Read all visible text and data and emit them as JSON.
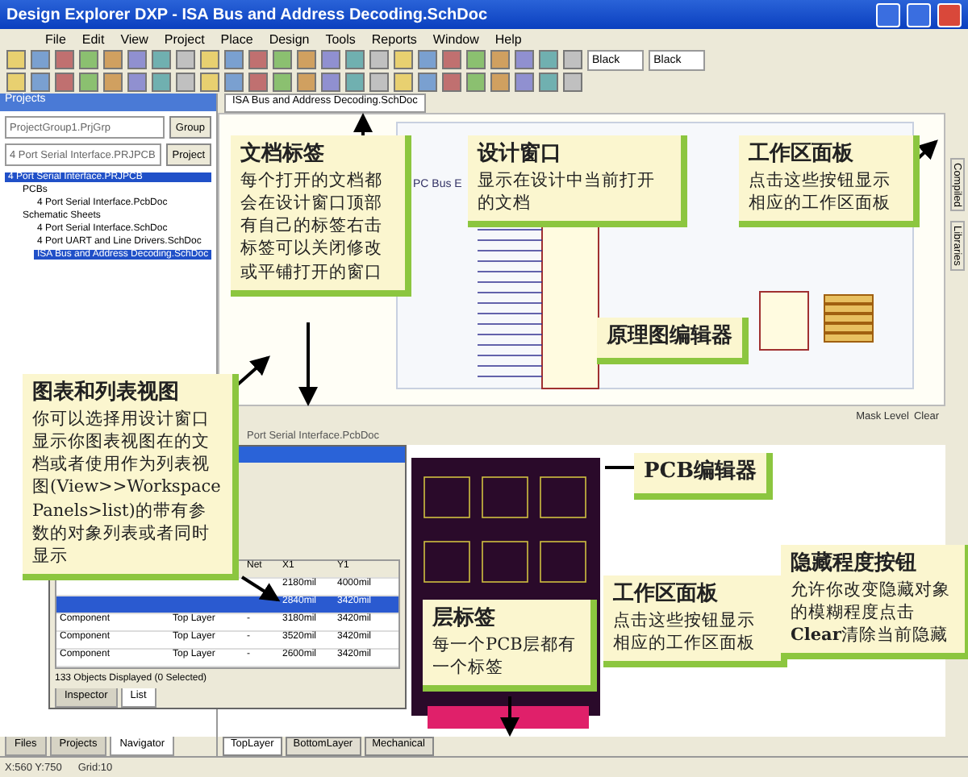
{
  "window": {
    "title": "Design Explorer DXP - ISA Bus and Address Decoding.SchDoc"
  },
  "menu": [
    "File",
    "Edit",
    "View",
    "Project",
    "Place",
    "Design",
    "Tools",
    "Reports",
    "Window",
    "Help"
  ],
  "toolbar": {
    "fill_color": "Black",
    "line_color": "Black"
  },
  "projects_panel": {
    "title": "Projects",
    "workspace": "ProjectGroup1.PrjGrp",
    "workspace_button": "Group",
    "project": "4 Port Serial Interface.PRJPCB",
    "project_button": "Project",
    "tree": [
      {
        "label": "4 Port Serial Interface.PRJPCB",
        "selected": true,
        "children": [
          {
            "label": "PCBs",
            "selected": false,
            "children": [
              {
                "label": "4 Port Serial Interface.PcbDoc",
                "selected": false
              }
            ]
          },
          {
            "label": "Schematic Sheets",
            "selected": false,
            "children": [
              {
                "label": "4 Port Serial Interface.SchDoc",
                "selected": false
              },
              {
                "label": "4 Port UART and Line Drivers.SchDoc",
                "selected": false
              },
              {
                "label": "ISA Bus and Address Decoding.SchDoc",
                "selected": true
              }
            ]
          }
        ]
      }
    ],
    "tabs": [
      {
        "label": "Files",
        "selected": false
      },
      {
        "label": "Projects",
        "selected": false
      },
      {
        "label": "Navigator",
        "selected": true
      }
    ]
  },
  "schematic_window": {
    "tab": "ISA Bus and Address Decoding.SchDoc",
    "sheet_label": "PC Bus E",
    "mask_level": "Mask Level",
    "clear": "Clear"
  },
  "side_panel_tabs": [
    "Compiled",
    "Libraries"
  ],
  "pcb_window": {
    "title": "Port Serial Interface.PcbDoc",
    "layer_tabs": [
      {
        "label": "TopLayer",
        "selected": true
      },
      {
        "label": "BottomLayer",
        "selected": false
      },
      {
        "label": "Mechanical",
        "selected": false
      }
    ]
  },
  "list_panel": {
    "columns": [
      "Net",
      "X1",
      "Y1"
    ],
    "rows": [
      {
        "x1": "2180mil",
        "y1": "4000mil",
        "selected": false
      },
      {
        "x1": "2840mil",
        "y1": "3420mil",
        "selected": true
      },
      {
        "object": "Component",
        "layer": "Top Layer",
        "net": "-",
        "x1": "3180mil",
        "y1": "3420mil",
        "selected": false
      },
      {
        "object": "Component",
        "layer": "Top Layer",
        "net": "-",
        "x1": "3520mil",
        "y1": "3420mil",
        "selected": false
      },
      {
        "object": "Component",
        "layer": "Top Layer",
        "net": "-",
        "x1": "2600mil",
        "y1": "3420mil",
        "selected": false
      }
    ],
    "summary": "133 Objects Displayed (0 Selected)",
    "tabs": [
      {
        "label": "Inspector",
        "selected": false
      },
      {
        "label": "List",
        "selected": true
      }
    ]
  },
  "status_bar": {
    "position": "X:560 Y:750",
    "grid": "Grid:10"
  },
  "callouts": [
    {
      "title": "文档标签",
      "body": "每个打开的文档都会在设计窗口顶部有自己的标签右击标签可以关闭修改或平铺打开的窗口"
    },
    {
      "title": "设计窗口",
      "body": "显示在设计中当前打开的文档"
    },
    {
      "title": "工作区面板",
      "body": "点击这些按钮显示相应的工作区面板"
    },
    {
      "title": "原理图编辑器"
    },
    {
      "title": "图表和列表视图",
      "body": "你可以选择用设计窗口显示你图表视图在的文档或者使用作为列表视图(View>>Workspace Panels>list)的带有参数的对象列表或者同时显示"
    },
    {
      "title": "PCB编辑器"
    },
    {
      "title": "层标签",
      "body": "每一个PCB层都有一个标签"
    },
    {
      "title": "工作区面板",
      "body": "点击这些按钮显示相应的工作区面板"
    },
    {
      "title": "隐藏程度按钮",
      "body": "允许你改变隐藏对象的模糊程度点击**Clear**清除当前隐藏"
    }
  ]
}
